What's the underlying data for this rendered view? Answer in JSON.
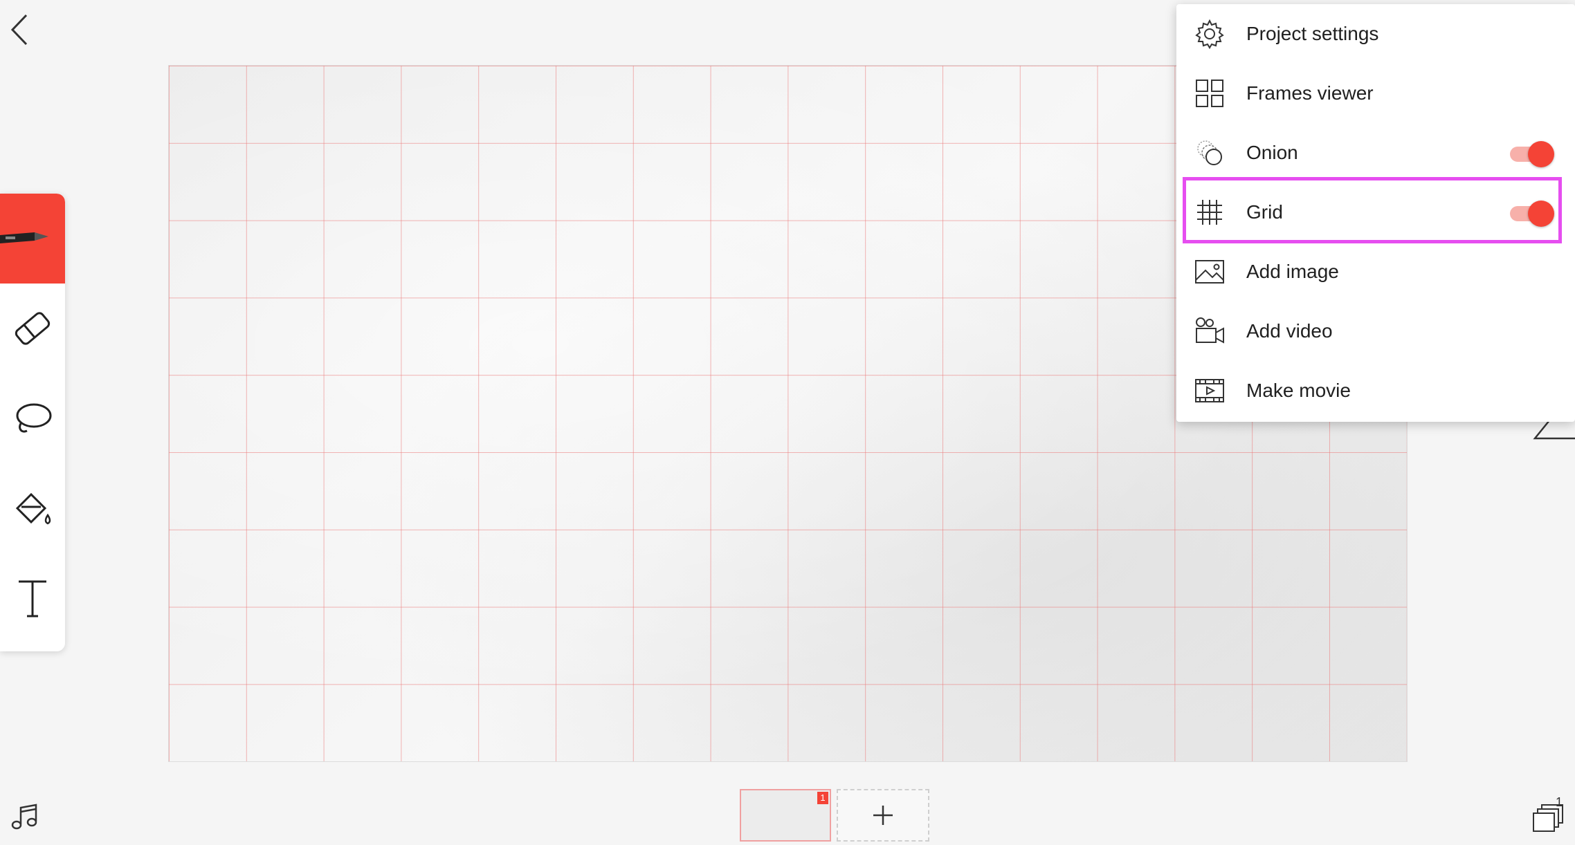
{
  "menu": {
    "items": [
      {
        "label": "Project settings",
        "icon": "gear-icon"
      },
      {
        "label": "Frames viewer",
        "icon": "grid-squares-icon"
      },
      {
        "label": "Onion",
        "icon": "onion-icon",
        "toggle": true
      },
      {
        "label": "Grid",
        "icon": "hash-grid-icon",
        "toggle": true
      },
      {
        "label": "Add image",
        "icon": "image-icon"
      },
      {
        "label": "Add video",
        "icon": "video-icon"
      },
      {
        "label": "Make movie",
        "icon": "film-icon"
      }
    ]
  },
  "timeline": {
    "frames": [
      {
        "number": "1"
      }
    ]
  },
  "layers": {
    "count": "1"
  },
  "colors": {
    "accent": "#f44336",
    "highlight": "#e64ef0",
    "grid_lines": "#eb7878"
  }
}
